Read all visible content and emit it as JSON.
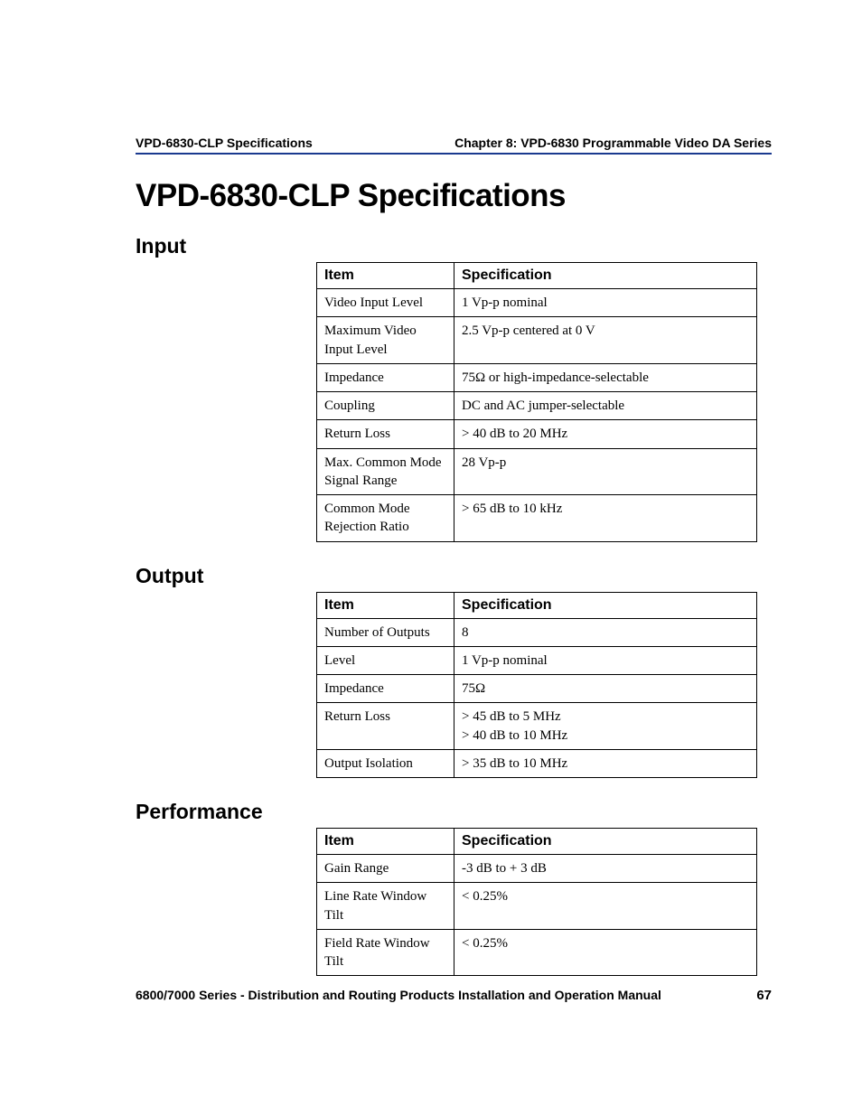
{
  "header": {
    "left": "VPD-6830-CLP Specifications",
    "right": "Chapter 8: VPD-6830 Programmable Video DA Series"
  },
  "title": "VPD-6830-CLP Specifications",
  "sections": {
    "input": {
      "heading": "Input",
      "col_item": "Item",
      "col_spec": "Specification",
      "rows": [
        {
          "item": "Video Input Level",
          "spec": "1 Vp-p nominal"
        },
        {
          "item": "Maximum Video Input Level",
          "spec": "2.5 Vp-p centered at 0 V"
        },
        {
          "item": "Impedance",
          "spec": "75Ω or high-impedance-selectable"
        },
        {
          "item": "Coupling",
          "spec": "DC and AC jumper-selectable"
        },
        {
          "item": "Return Loss",
          "spec": "> 40 dB to 20 MHz"
        },
        {
          "item": "Max. Common Mode Signal Range",
          "spec": "28 Vp-p"
        },
        {
          "item": "Common Mode Rejection Ratio",
          "spec": "> 65 dB to 10 kHz"
        }
      ]
    },
    "output": {
      "heading": "Output",
      "col_item": "Item",
      "col_spec": "Specification",
      "rows": [
        {
          "item": "Number of Outputs",
          "spec": "8"
        },
        {
          "item": "Level",
          "spec": "1 Vp-p nominal"
        },
        {
          "item": "Impedance",
          "spec": "75Ω"
        },
        {
          "item": "Return Loss",
          "spec_line1": "> 45 dB to 5 MHz",
          "spec_line2": "> 40 dB to 10 MHz"
        },
        {
          "item": "Output Isolation",
          "spec": "> 35 dB to 10 MHz"
        }
      ]
    },
    "performance": {
      "heading": "Performance",
      "col_item": "Item",
      "col_spec": "Specification",
      "rows": [
        {
          "item": "Gain Range",
          "spec": "-3 dB to + 3 dB"
        },
        {
          "item": "Line Rate Window Tilt",
          "spec": "< 0.25%"
        },
        {
          "item": "Field Rate Window Tilt",
          "spec": "< 0.25%"
        }
      ]
    }
  },
  "footer": {
    "text": "6800/7000 Series - Distribution and Routing Products Installation and Operation Manual",
    "page": "67"
  }
}
